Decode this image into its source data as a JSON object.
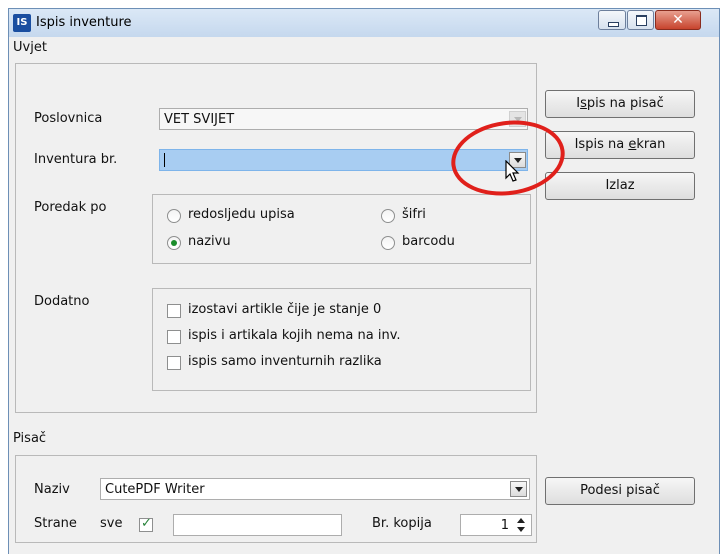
{
  "window": {
    "app_icon_text": "IS",
    "title": "Ispis inventure",
    "close_glyph": "✕"
  },
  "uvjet": {
    "section_label": "Uvjet",
    "poslovnica": {
      "label": "Poslovnica",
      "value": "VET SVIJET"
    },
    "inventura": {
      "label": "Inventura br.",
      "value": ""
    },
    "poredak": {
      "label": "Poredak po",
      "options": [
        {
          "label": "redosljedu upisa",
          "selected": false
        },
        {
          "label": "šifri",
          "selected": false
        },
        {
          "label": "nazivu",
          "selected": true
        },
        {
          "label": "barcodu",
          "selected": false
        }
      ]
    },
    "dodatno": {
      "label": "Dodatno",
      "options": [
        {
          "label": "izostavi artikle čije je stanje 0",
          "checked": false
        },
        {
          "label": "ispis i artikala kojih nema na inv.",
          "checked": false
        },
        {
          "label": "ispis samo inventurnih razlika",
          "checked": false
        }
      ]
    }
  },
  "actions": {
    "ispis_na_pisac": {
      "pre": "I",
      "ul": "s",
      "post": "pis na pisač"
    },
    "ispis_na_ekran": {
      "pre": "Ispis na ",
      "ul": "e",
      "post": "kran"
    },
    "izlaz": "Izlaz"
  },
  "pisac": {
    "section_label": "Pisač",
    "naziv": {
      "label": "Naziv",
      "value": "CutePDF Writer"
    },
    "strane": {
      "label": "Strane",
      "sve_label": "sve",
      "sve_checked": true,
      "range_value": ""
    },
    "kopija": {
      "label": "Br. kopija",
      "value": "1"
    },
    "podesi_label": "Podesi pisač"
  },
  "colors": {
    "highlight_ellipse": "#e0201b",
    "focus_field": "#a8cdf2"
  }
}
